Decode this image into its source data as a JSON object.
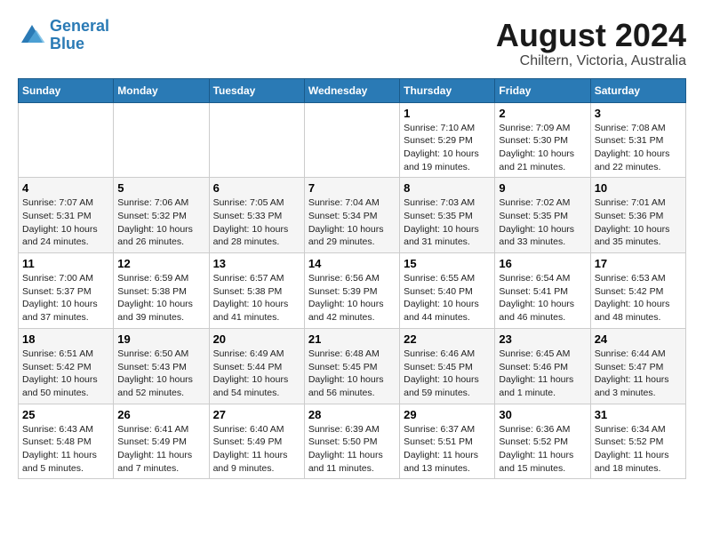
{
  "logo": {
    "line1": "General",
    "line2": "Blue"
  },
  "title": "August 2024",
  "subtitle": "Chiltern, Victoria, Australia",
  "days_header": [
    "Sunday",
    "Monday",
    "Tuesday",
    "Wednesday",
    "Thursday",
    "Friday",
    "Saturday"
  ],
  "weeks": [
    [
      {
        "day": "",
        "info": ""
      },
      {
        "day": "",
        "info": ""
      },
      {
        "day": "",
        "info": ""
      },
      {
        "day": "",
        "info": ""
      },
      {
        "day": "1",
        "info": "Sunrise: 7:10 AM\nSunset: 5:29 PM\nDaylight: 10 hours\nand 19 minutes."
      },
      {
        "day": "2",
        "info": "Sunrise: 7:09 AM\nSunset: 5:30 PM\nDaylight: 10 hours\nand 21 minutes."
      },
      {
        "day": "3",
        "info": "Sunrise: 7:08 AM\nSunset: 5:31 PM\nDaylight: 10 hours\nand 22 minutes."
      }
    ],
    [
      {
        "day": "4",
        "info": "Sunrise: 7:07 AM\nSunset: 5:31 PM\nDaylight: 10 hours\nand 24 minutes."
      },
      {
        "day": "5",
        "info": "Sunrise: 7:06 AM\nSunset: 5:32 PM\nDaylight: 10 hours\nand 26 minutes."
      },
      {
        "day": "6",
        "info": "Sunrise: 7:05 AM\nSunset: 5:33 PM\nDaylight: 10 hours\nand 28 minutes."
      },
      {
        "day": "7",
        "info": "Sunrise: 7:04 AM\nSunset: 5:34 PM\nDaylight: 10 hours\nand 29 minutes."
      },
      {
        "day": "8",
        "info": "Sunrise: 7:03 AM\nSunset: 5:35 PM\nDaylight: 10 hours\nand 31 minutes."
      },
      {
        "day": "9",
        "info": "Sunrise: 7:02 AM\nSunset: 5:35 PM\nDaylight: 10 hours\nand 33 minutes."
      },
      {
        "day": "10",
        "info": "Sunrise: 7:01 AM\nSunset: 5:36 PM\nDaylight: 10 hours\nand 35 minutes."
      }
    ],
    [
      {
        "day": "11",
        "info": "Sunrise: 7:00 AM\nSunset: 5:37 PM\nDaylight: 10 hours\nand 37 minutes."
      },
      {
        "day": "12",
        "info": "Sunrise: 6:59 AM\nSunset: 5:38 PM\nDaylight: 10 hours\nand 39 minutes."
      },
      {
        "day": "13",
        "info": "Sunrise: 6:57 AM\nSunset: 5:38 PM\nDaylight: 10 hours\nand 41 minutes."
      },
      {
        "day": "14",
        "info": "Sunrise: 6:56 AM\nSunset: 5:39 PM\nDaylight: 10 hours\nand 42 minutes."
      },
      {
        "day": "15",
        "info": "Sunrise: 6:55 AM\nSunset: 5:40 PM\nDaylight: 10 hours\nand 44 minutes."
      },
      {
        "day": "16",
        "info": "Sunrise: 6:54 AM\nSunset: 5:41 PM\nDaylight: 10 hours\nand 46 minutes."
      },
      {
        "day": "17",
        "info": "Sunrise: 6:53 AM\nSunset: 5:42 PM\nDaylight: 10 hours\nand 48 minutes."
      }
    ],
    [
      {
        "day": "18",
        "info": "Sunrise: 6:51 AM\nSunset: 5:42 PM\nDaylight: 10 hours\nand 50 minutes."
      },
      {
        "day": "19",
        "info": "Sunrise: 6:50 AM\nSunset: 5:43 PM\nDaylight: 10 hours\nand 52 minutes."
      },
      {
        "day": "20",
        "info": "Sunrise: 6:49 AM\nSunset: 5:44 PM\nDaylight: 10 hours\nand 54 minutes."
      },
      {
        "day": "21",
        "info": "Sunrise: 6:48 AM\nSunset: 5:45 PM\nDaylight: 10 hours\nand 56 minutes."
      },
      {
        "day": "22",
        "info": "Sunrise: 6:46 AM\nSunset: 5:45 PM\nDaylight: 10 hours\nand 59 minutes."
      },
      {
        "day": "23",
        "info": "Sunrise: 6:45 AM\nSunset: 5:46 PM\nDaylight: 11 hours\nand 1 minute."
      },
      {
        "day": "24",
        "info": "Sunrise: 6:44 AM\nSunset: 5:47 PM\nDaylight: 11 hours\nand 3 minutes."
      }
    ],
    [
      {
        "day": "25",
        "info": "Sunrise: 6:43 AM\nSunset: 5:48 PM\nDaylight: 11 hours\nand 5 minutes."
      },
      {
        "day": "26",
        "info": "Sunrise: 6:41 AM\nSunset: 5:49 PM\nDaylight: 11 hours\nand 7 minutes."
      },
      {
        "day": "27",
        "info": "Sunrise: 6:40 AM\nSunset: 5:49 PM\nDaylight: 11 hours\nand 9 minutes."
      },
      {
        "day": "28",
        "info": "Sunrise: 6:39 AM\nSunset: 5:50 PM\nDaylight: 11 hours\nand 11 minutes."
      },
      {
        "day": "29",
        "info": "Sunrise: 6:37 AM\nSunset: 5:51 PM\nDaylight: 11 hours\nand 13 minutes."
      },
      {
        "day": "30",
        "info": "Sunrise: 6:36 AM\nSunset: 5:52 PM\nDaylight: 11 hours\nand 15 minutes."
      },
      {
        "day": "31",
        "info": "Sunrise: 6:34 AM\nSunset: 5:52 PM\nDaylight: 11 hours\nand 18 minutes."
      }
    ]
  ]
}
